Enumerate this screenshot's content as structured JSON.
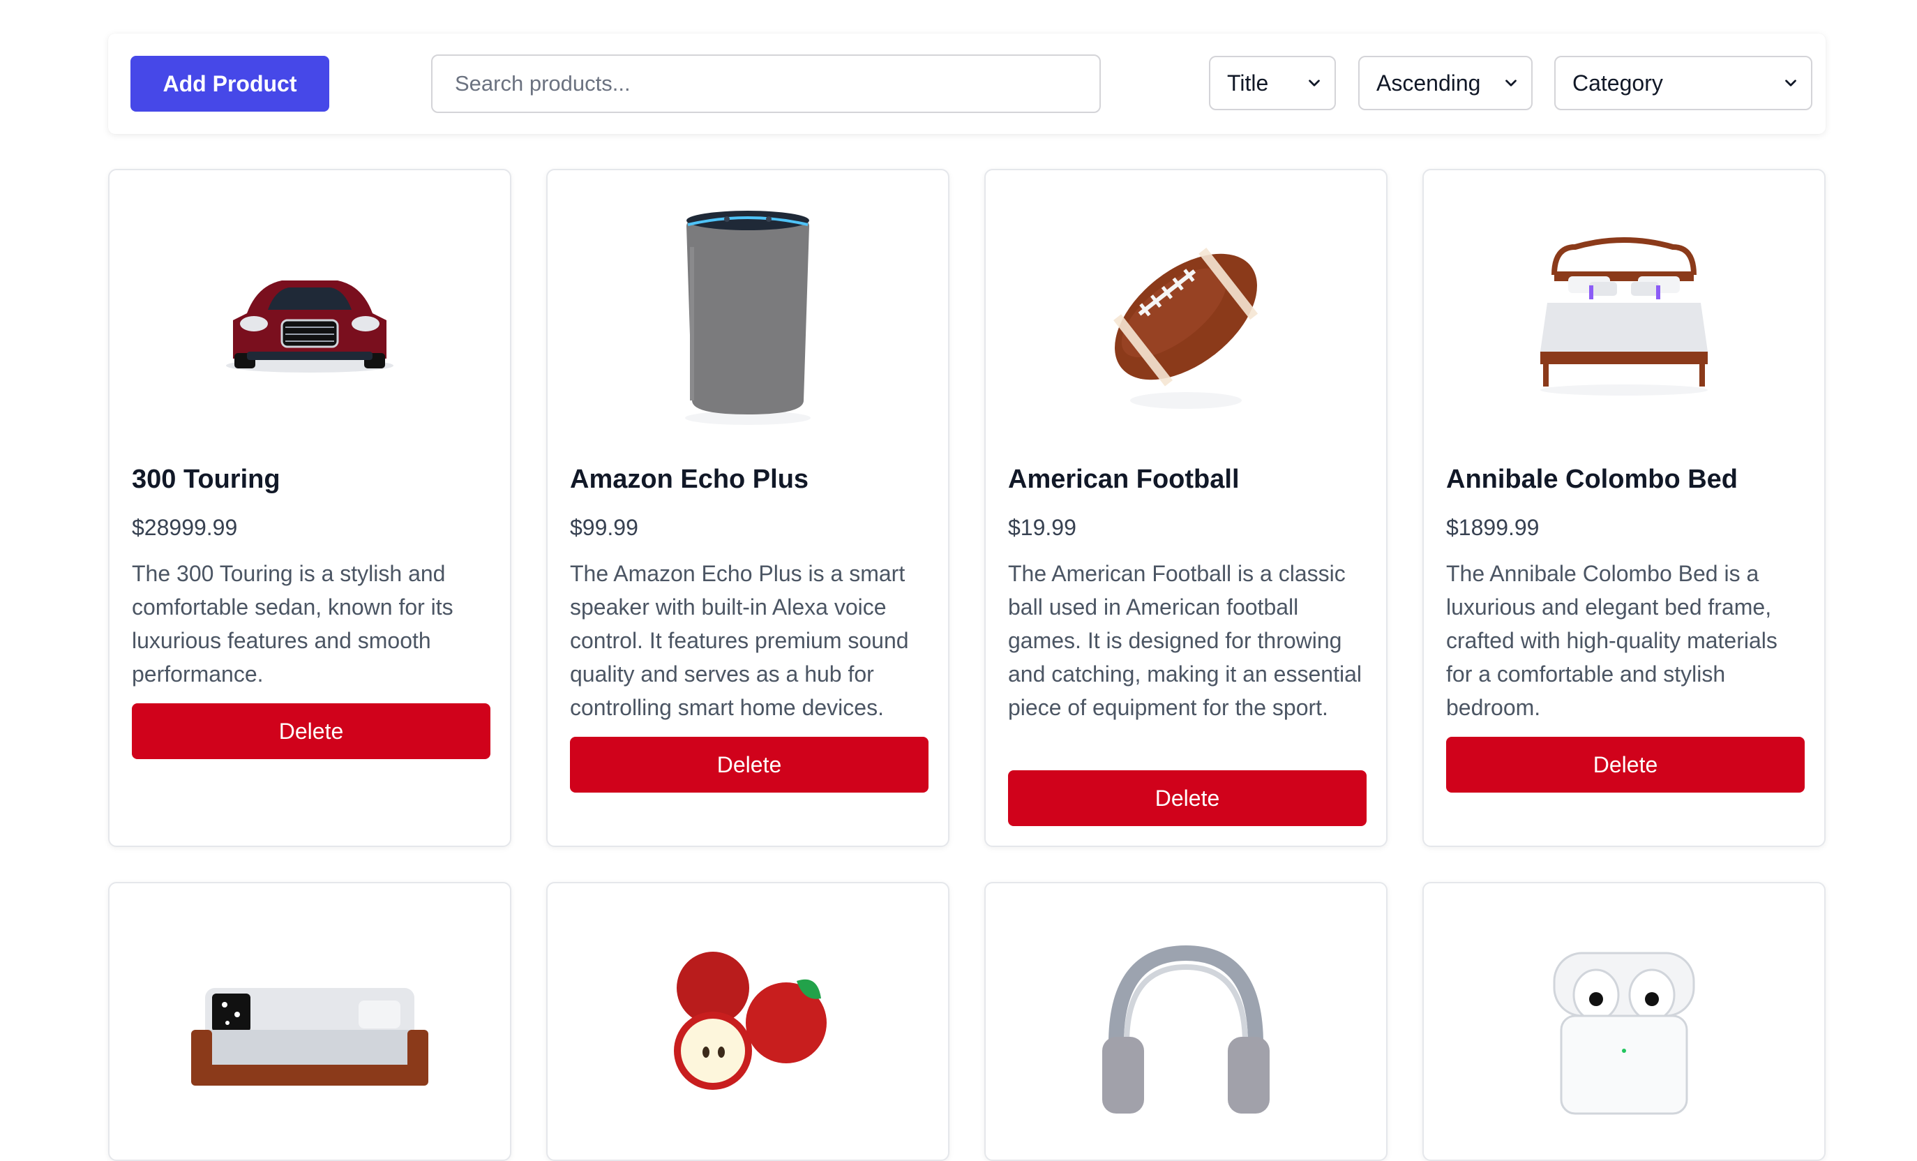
{
  "toolbar": {
    "add_label": "Add Product",
    "search_placeholder": "Search products...",
    "sort_field": "Title",
    "sort_order": "Ascending",
    "category": "Category",
    "accent_color": "#4648e8"
  },
  "products": [
    {
      "title": "300 Touring",
      "price": "$28999.99",
      "description": "The 300 Touring is a stylish and comfortable sedan, known for its luxurious features and smooth performance.",
      "delete_label": "Delete",
      "image": "car-image"
    },
    {
      "title": "Amazon Echo Plus",
      "price": "$99.99",
      "description": "The Amazon Echo Plus is a smart speaker with built-in Alexa voice control. It features premium sound quality and serves as a hub for controlling smart home devices.",
      "delete_label": "Delete",
      "image": "smart-speaker-image"
    },
    {
      "title": "American Football",
      "price": "$19.99",
      "description": "The American Football is a classic ball used in American football games. It is designed for throwing and catching, making it an essential piece of equipment for the sport.",
      "delete_label": "Delete",
      "image": "football-image"
    },
    {
      "title": "Annibale Colombo Bed",
      "price": "$1899.99",
      "description": "The Annibale Colombo Bed is a luxurious and elegant bed frame, crafted with high-quality materials for a comfortable and stylish bedroom.",
      "delete_label": "Delete",
      "image": "bed-image"
    },
    {
      "image": "sofa-image"
    },
    {
      "image": "apples-image"
    },
    {
      "image": "headphones-image"
    },
    {
      "image": "earbuds-case-image"
    }
  ],
  "delete_color": "#d0021b"
}
